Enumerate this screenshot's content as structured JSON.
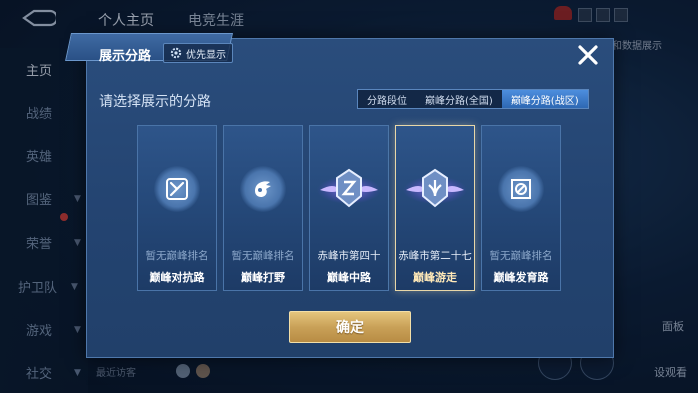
{
  "background": {
    "top_nav": [
      "个人主页",
      "电竞生涯"
    ],
    "sidebar": [
      {
        "label": "主页",
        "active": true
      },
      {
        "label": "战绩",
        "active": false
      },
      {
        "label": "英雄",
        "active": false
      },
      {
        "label": "图鉴",
        "active": false
      },
      {
        "label": "荣誉",
        "active": false
      },
      {
        "label": "护卫队",
        "active": false
      },
      {
        "label": "游戏",
        "active": false
      },
      {
        "label": "社交",
        "active": false
      }
    ],
    "right_label": "和数据展示",
    "bottom_text": "最近访客",
    "right_side": [
      "面板",
      "设观看"
    ]
  },
  "modal": {
    "title": "展示分路",
    "priority_label": "优先显示",
    "subtitle": "请选择展示的分路",
    "tabs": [
      {
        "label": "分路段位",
        "selected": false
      },
      {
        "label": "巅峰分路(全国)",
        "selected": false
      },
      {
        "label": "巅峰分路(战区)",
        "selected": true
      }
    ],
    "cards": [
      {
        "icon": "sword-crossed-icon",
        "rank": "暂无巅峰排名",
        "lane": "巅峰对抗路",
        "selected": false
      },
      {
        "icon": "jungle-dragon-icon",
        "rank": "暂无巅峰排名",
        "lane": "巅峰打野",
        "selected": false
      },
      {
        "icon": "winged-emblem-mid-icon",
        "rank": "赤峰市第四十",
        "lane": "巅峰中路",
        "selected": false
      },
      {
        "icon": "winged-emblem-roam-icon",
        "rank": "赤峰市第二十七",
        "lane": "巅峰游走",
        "selected": true
      },
      {
        "icon": "farm-lane-icon",
        "rank": "暂无巅峰排名",
        "lane": "巅峰发育路",
        "selected": false
      }
    ],
    "confirm_label": "确定",
    "accent_color": "#e5c57d"
  }
}
